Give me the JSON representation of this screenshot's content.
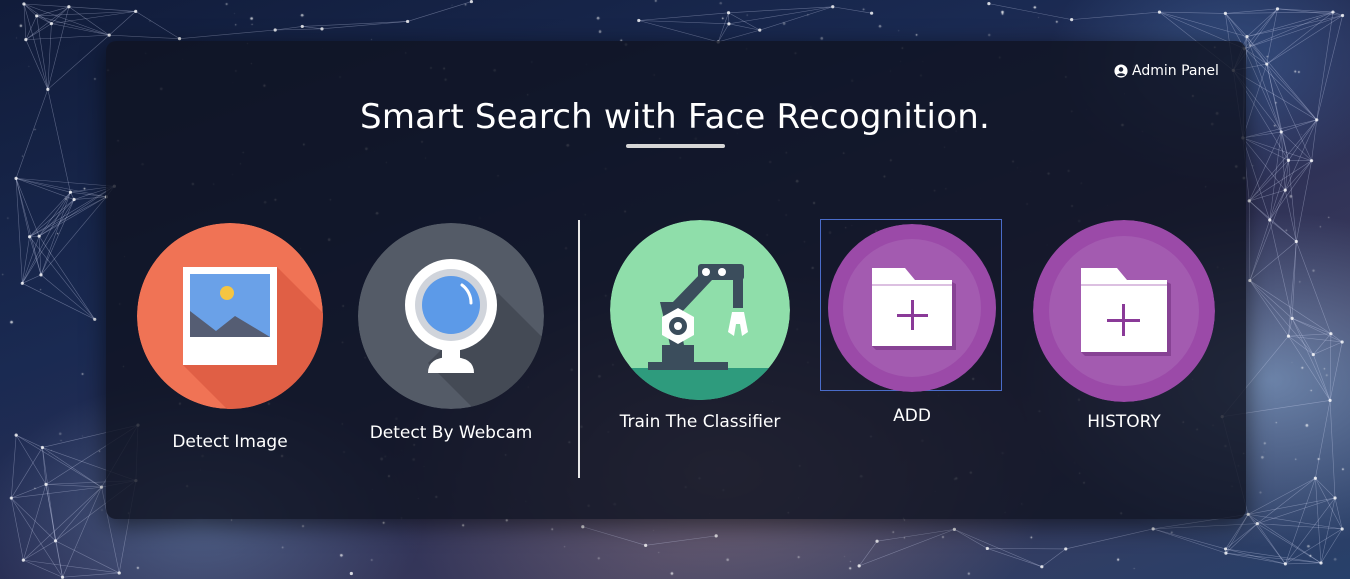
{
  "header": {
    "title": "Smart Search with Face Recognition.",
    "admin_label": "Admin Panel",
    "admin_icon": "user-circle-icon"
  },
  "tiles": [
    {
      "label": "Detect Image",
      "icon": "image-icon",
      "color": "#f07355"
    },
    {
      "label": "Detect By Webcam",
      "icon": "webcam-icon",
      "color": "#545b67"
    },
    {
      "label": "Train The Classifier",
      "icon": "robot-arm-icon",
      "color": "#8fdeaa"
    },
    {
      "label": "ADD",
      "icon": "folder-add-icon",
      "color": "#9b4aa8"
    },
    {
      "label": "HISTORY",
      "icon": "folder-add-icon",
      "color": "#9b4aa8"
    }
  ]
}
